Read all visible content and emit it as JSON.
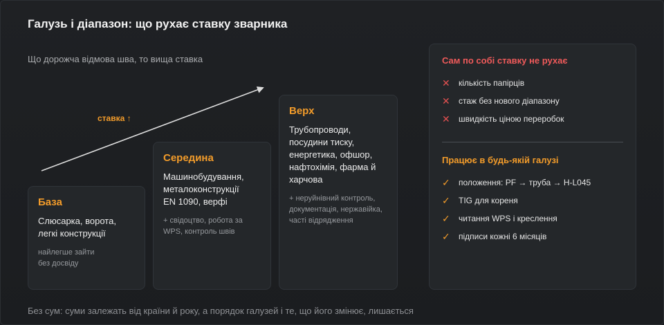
{
  "header": {
    "title": "Галузь і діапазон: що рухає ставку зварника",
    "subtitle": "Що дорожча відмова шва, то вища ставка"
  },
  "arrow": {
    "label": "ставка ↑"
  },
  "tiers": [
    {
      "title": "База",
      "body": "Слюсарка, ворота, легкі конструкції",
      "note": "найлегше зайти без досвіду"
    },
    {
      "title": "Середина",
      "body": "Машинобудування, металоконструкції EN 1090, верфі",
      "note": "+ свідоцтво, робота за WPS, контроль швів"
    },
    {
      "title": "Верх",
      "body": "Трубопроводи, посудини тиску, енергетика, офшор, нафтохімія, фарма й харчова",
      "note": "+ неруйнівний контроль, документація, нержавійка, часті відрядження"
    }
  ],
  "panel": {
    "not_rate_title": "Сам по собі ставку не рухає",
    "not_rate_items": [
      "кількість папірців",
      "стаж без нового діапазону",
      "швидкість ціною переробок"
    ],
    "works_title": "Працює в будь-якій галузі",
    "works_items": [
      "положення: PF → труба → H-L045",
      "TIG для кореня",
      "читання WPS і креслення",
      "підписи кожні 6 місяців"
    ],
    "x_glyph": "✕",
    "check_glyph": "✓"
  },
  "footer": "Без сум: суми залежать від країни й року, а порядок галузей і те, що його змінює, лишається",
  "colors": {
    "accent": "#f39c2a",
    "negative": "#e05050",
    "background": "#1c1e21"
  }
}
